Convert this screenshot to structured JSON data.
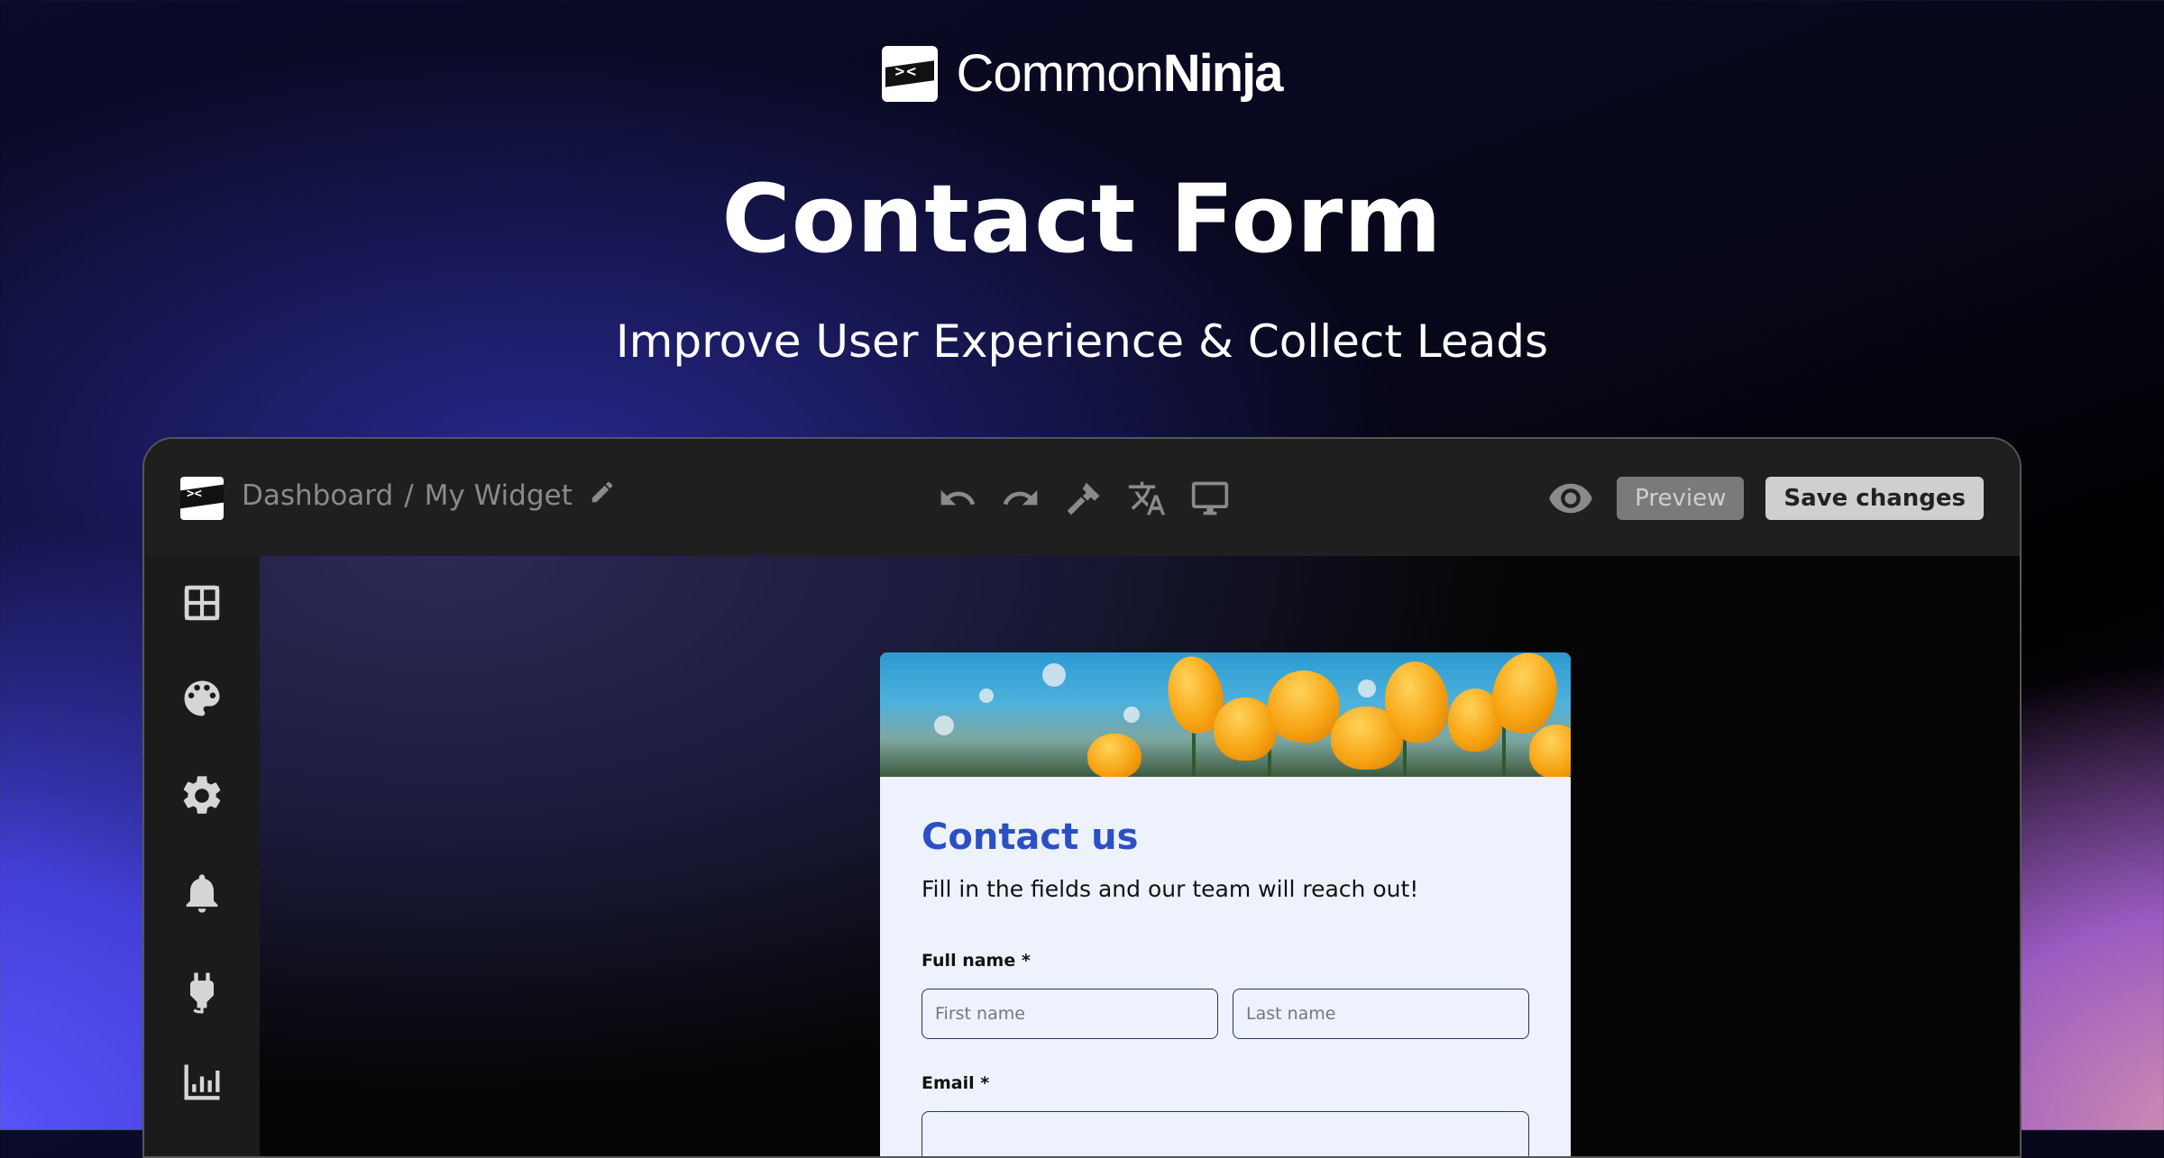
{
  "brand": {
    "name_light": "Common",
    "name_bold": "Ninja",
    "logo_icon": "ninja-logo-icon"
  },
  "hero": {
    "title": "Contact Form",
    "subtitle": "Improve User Experience & Collect Leads"
  },
  "editor": {
    "breadcrumb": {
      "root": "Dashboard",
      "separator": "/",
      "current": "My Widget"
    },
    "toolbar_icons": [
      "undo-icon",
      "redo-icon",
      "hammer-icon",
      "translate-icon",
      "desktop-icon"
    ],
    "preview_label": "Preview",
    "save_label": "Save changes",
    "sidebar_icons": [
      "layout-icon",
      "palette-icon",
      "gear-icon",
      "bell-icon",
      "plug-icon",
      "chart-icon"
    ]
  },
  "form": {
    "title": "Contact us",
    "description": "Fill in the fields and our team will reach out!",
    "full_name_label": "Full name *",
    "first_name_placeholder": "First name",
    "last_name_placeholder": "Last name",
    "email_label": "Email *",
    "email_placeholder": ""
  },
  "colors": {
    "accent": "#2b4fc4",
    "form_bg": "#edf2fc",
    "topbar_bg": "#1f1f1f"
  }
}
